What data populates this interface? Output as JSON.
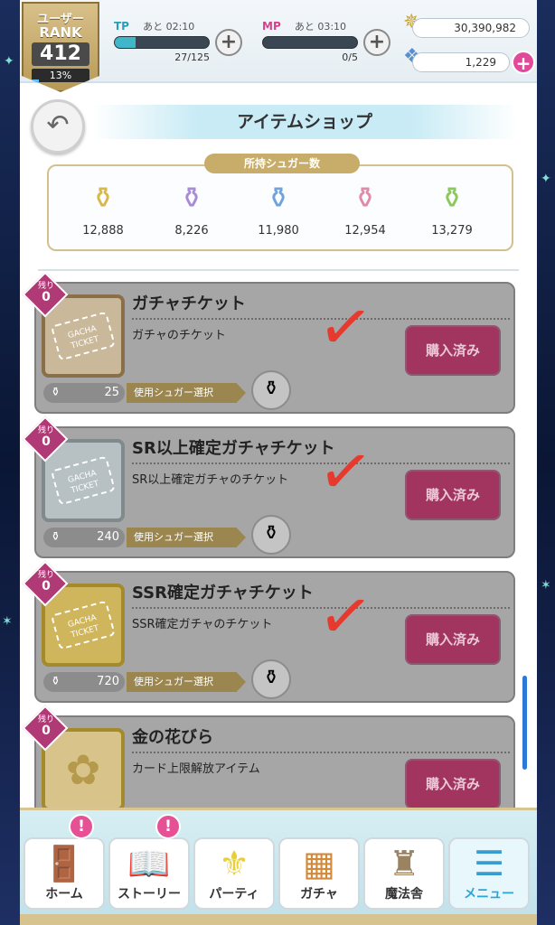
{
  "user": {
    "rank_label_1": "ユーザー",
    "rank_label_2": "RANK",
    "rank": "412",
    "rank_progress": "13%"
  },
  "tp": {
    "label": "TP",
    "time": "あと 02:10",
    "count": "27/125",
    "fill": 0.22
  },
  "mp": {
    "label": "MP",
    "time": "あと 03:10",
    "count": "0/5",
    "fill": 0.0
  },
  "currency": {
    "gold": "30,390,982",
    "crystals": "1,229"
  },
  "header": {
    "title": "アイテムショップ"
  },
  "sugar": {
    "label": "所持シュガー数",
    "items": [
      {
        "icon": "yellow-sugar-bottle",
        "amount": "12,888"
      },
      {
        "icon": "purple-sugar-bottle",
        "amount": "8,226"
      },
      {
        "icon": "blue-sugar-bottle",
        "amount": "11,980"
      },
      {
        "icon": "pink-sugar-bottle",
        "amount": "12,954"
      },
      {
        "icon": "green-sugar-bottle",
        "amount": "13,279"
      }
    ]
  },
  "items": [
    {
      "remain_label": "残り",
      "remain": "0",
      "name": "ガチャチケット",
      "desc": "ガチャのチケット",
      "cost": "25",
      "select": "使用シュガー選択",
      "buy": "購入済み",
      "ticket_text": "GACHA TICKET"
    },
    {
      "remain_label": "残り",
      "remain": "0",
      "name": "SR以上確定ガチャチケット",
      "desc": "SR以上確定ガチャのチケット",
      "cost": "240",
      "select": "使用シュガー選択",
      "buy": "購入済み",
      "ticket_text": "GACHA TICKET"
    },
    {
      "remain_label": "残り",
      "remain": "0",
      "name": "SSR確定ガチャチケット",
      "desc": "SSR確定ガチャのチケット",
      "cost": "720",
      "select": "使用シュガー選択",
      "buy": "購入済み",
      "ticket_text": "GACHA TICKET"
    },
    {
      "remain_label": "残り",
      "remain": "0",
      "name": "金の花びら",
      "desc": "カード上限解放アイテム",
      "buy": "購入済み"
    }
  ],
  "nav": {
    "home": "ホーム",
    "story": "ストーリー",
    "party": "パーティ",
    "gacha": "ガチャ",
    "school": "魔法舎",
    "menu": "メニュー",
    "notif": "!"
  }
}
